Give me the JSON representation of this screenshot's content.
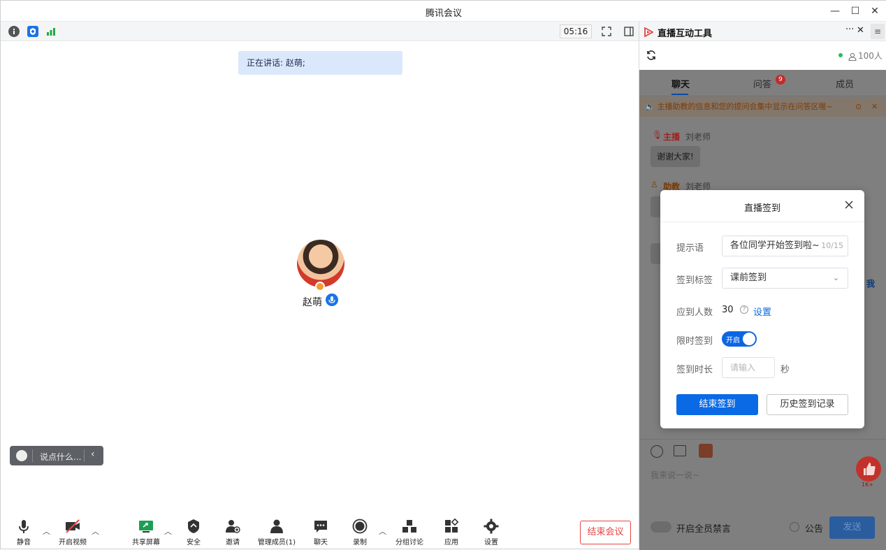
{
  "window": {
    "title": "腾讯会议",
    "minimize": "—",
    "maximize": "☐",
    "close": "✕"
  },
  "meeting": {
    "timer": "05:16",
    "speaking": "正在讲话: 赵萌;",
    "participant_name": "赵萌",
    "chat_placeholder": "说点什么...",
    "toolbar": {
      "mute": "静音",
      "video": "开启视频",
      "share": "共享屏幕",
      "security": "安全",
      "invite": "邀请",
      "manage": "管理成员(1)",
      "chat": "聊天",
      "record": "录制",
      "breakout": "分组讨论",
      "apps": "应用",
      "settings": "设置"
    },
    "end_button": "结束会议"
  },
  "live_panel": {
    "title": "直播互动工具",
    "more": "···",
    "close": "✕",
    "menu": "≡",
    "online_count": "100人",
    "tabs": {
      "chat": "聊天",
      "qa": "问答",
      "qa_badge": "9",
      "members": "成员"
    },
    "notice": "主播助教的信息和您的提问会集中显示在问答区喔~",
    "messages": [
      {
        "role": "主播",
        "name": "刘老师",
        "text": "谢谢大家!"
      },
      {
        "role": "助教",
        "name": "刘老师",
        "text": ""
      }
    ],
    "edge_text": "我",
    "input_placeholder": "我来说一说~",
    "like_count": "1K+",
    "mute_all": "开启全员禁言",
    "announcement": "公告",
    "send": "发送"
  },
  "dialog": {
    "title": "直播签到",
    "prompt_label": "提示语",
    "prompt_value": "各位同学开始签到啦~",
    "prompt_count": "10/15",
    "tag_label": "签到标签",
    "tag_value": "课前签到",
    "expected_label": "应到人数",
    "expected_value": "30",
    "expected_link": "设置",
    "timed_label": "限时签到",
    "timed_toggle": "开启",
    "duration_label": "签到时长",
    "duration_placeholder": "请输入",
    "duration_unit": "秒",
    "end_button": "结束签到",
    "history_button": "历史签到记录"
  },
  "colors": {
    "primary": "#0a6ae5",
    "danger": "#e54545",
    "speaking_bg": "#dbe7fb"
  }
}
